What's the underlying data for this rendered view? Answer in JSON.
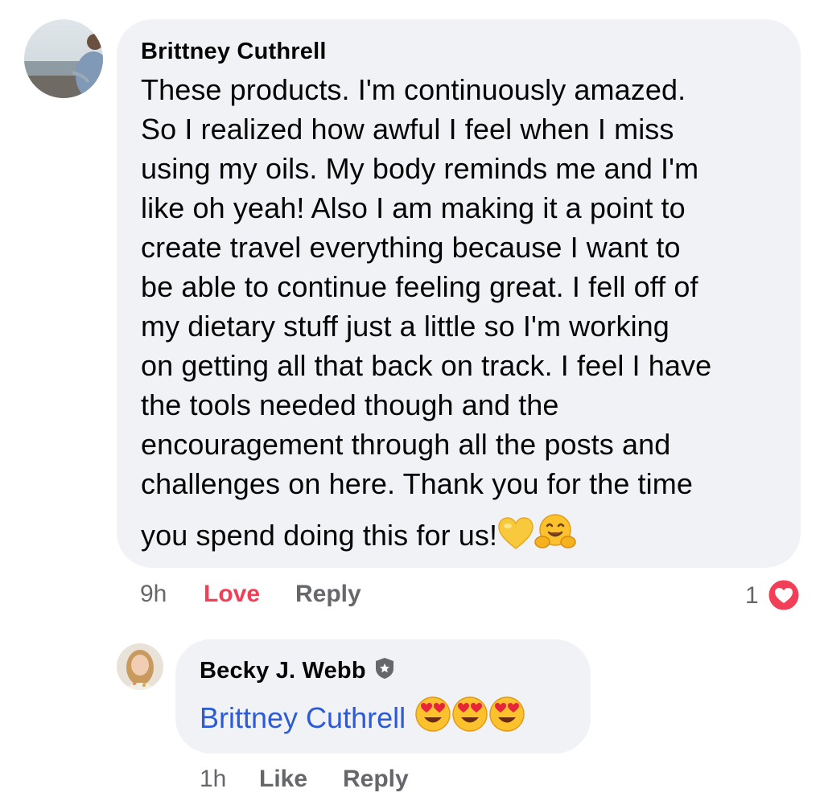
{
  "comment": {
    "author": "Brittney Cuthrell",
    "text_lines": [
      "These products. I'm continuously amazed.",
      "So I realized how awful I feel when I miss",
      "using my oils. My body reminds me and I'm",
      "like oh yeah! Also I am making it a point to",
      "create travel everything because I want to",
      "be able to continue feeling great. I fell off of",
      "my dietary stuff just a little so I'm working",
      "on getting all that back on track. I feel I have",
      "the tools needed though and the",
      "encouragement through all the posts and",
      "challenges on here. Thank you for the time",
      "you spend doing this for us!"
    ],
    "emojis": [
      "yellow-heart",
      "hugging-face"
    ],
    "time": "9h",
    "love_label": "Love",
    "reply_label": "Reply",
    "reaction_count": "1",
    "reaction_type": "love"
  },
  "reply": {
    "author": "Becky J. Webb",
    "author_badge": "shield-badge",
    "mention": "Brittney Cuthrell",
    "emojis": [
      "heart-eyes",
      "heart-eyes",
      "heart-eyes"
    ],
    "time": "1h",
    "like_label": "Like",
    "reply_label": "Reply"
  },
  "colors": {
    "bubble": "#f0f2f5",
    "love": "#f33e58",
    "mention": "#2d5bd6",
    "meta": "#65676b"
  }
}
